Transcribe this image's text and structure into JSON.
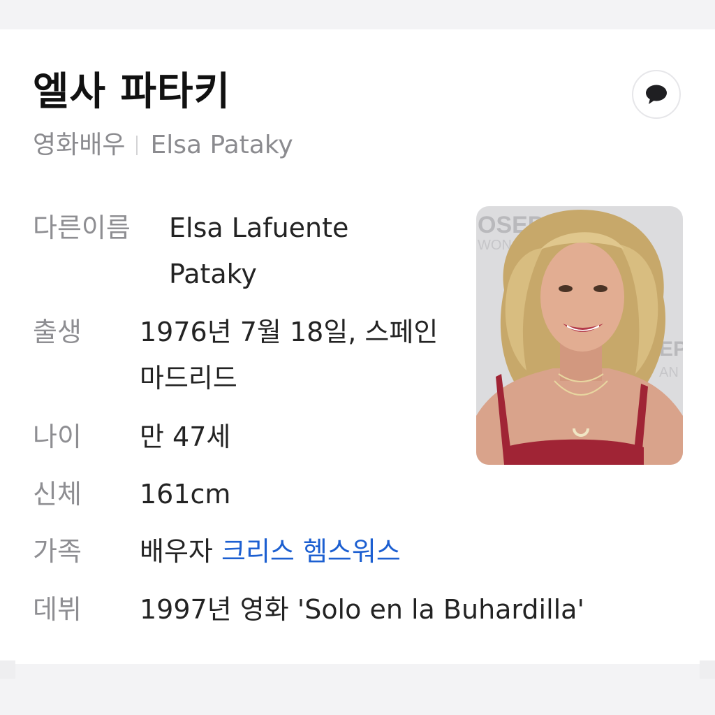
{
  "profile": {
    "name": "엘사 파타키",
    "occupation": "영화배우",
    "english_name": "Elsa Pataky",
    "talk_icon": "speech-bubble-icon"
  },
  "details": {
    "alt_name": {
      "label": "다른이름",
      "value": "Elsa Lafuente Pataky"
    },
    "birth": {
      "label": "출생",
      "value": "1976년 7월 18일, 스페인 마드리드"
    },
    "age": {
      "label": "나이",
      "value": "만 47세"
    },
    "body": {
      "label": "신체",
      "value": "161cm"
    },
    "family": {
      "label": "가족",
      "relation": "배우자",
      "spouse": "크리스 헴스워스"
    },
    "debut": {
      "label": "데뷔",
      "value": "1997년 영화 'Solo en la Buhardilla'"
    }
  },
  "photo": {
    "backdrop_text_1": "OSEP",
    "backdrop_text_2": "WON",
    "backdrop_text_3": "EP",
    "backdrop_text_4": "AN"
  },
  "colors": {
    "link": "#1c5fd1",
    "label": "#8e8e92",
    "text": "#232323",
    "title": "#111111"
  }
}
